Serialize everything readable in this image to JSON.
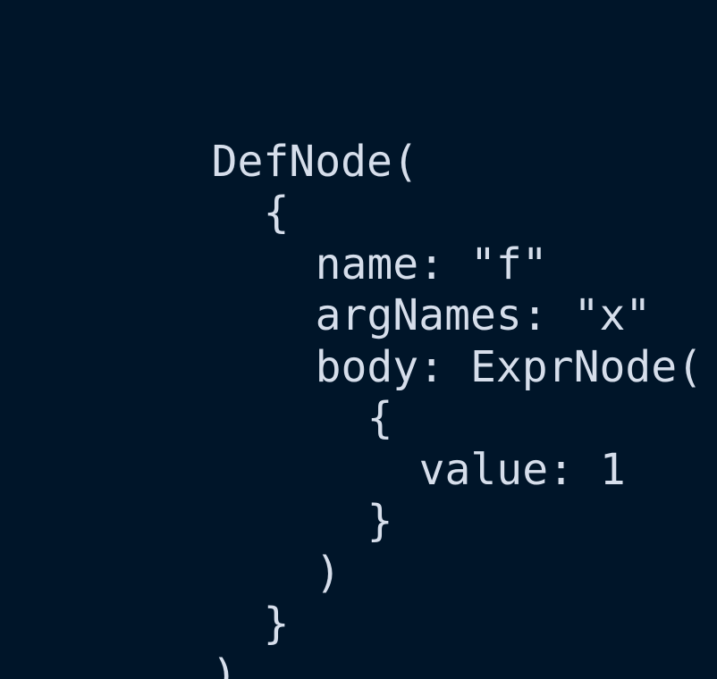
{
  "code": {
    "lines": [
      {
        "indent": 0,
        "text": "DefNode("
      },
      {
        "indent": 1,
        "text": "{"
      },
      {
        "indent": 2,
        "text": "name: \"f\""
      },
      {
        "indent": 2,
        "text": "argNames: \"x\""
      },
      {
        "indent": 2,
        "text": "body: ExprNode("
      },
      {
        "indent": 3,
        "text": "{"
      },
      {
        "indent": 4,
        "text": "value: 1"
      },
      {
        "indent": 3,
        "text": "}"
      },
      {
        "indent": 2,
        "text": ")"
      },
      {
        "indent": 1,
        "text": "}"
      },
      {
        "indent": 0,
        "text": ")"
      }
    ]
  },
  "colors": {
    "background": "#001529",
    "text": "#d6deeb"
  }
}
